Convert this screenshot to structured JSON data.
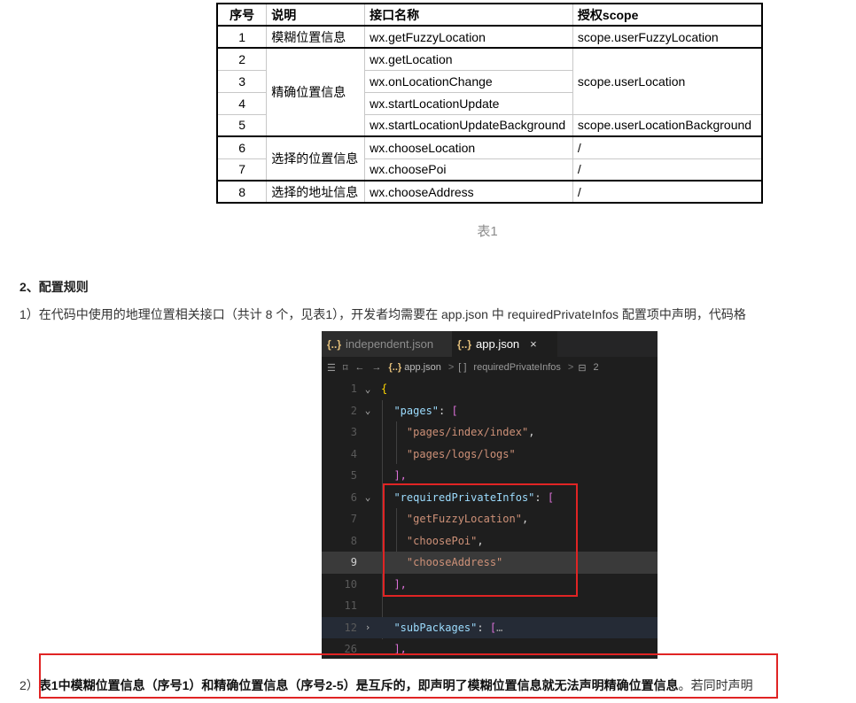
{
  "table": {
    "headers": [
      "序号",
      "说明",
      "接口名称",
      "授权scope"
    ],
    "rows": [
      {
        "no": "1",
        "desc": "模糊位置信息",
        "api": "wx.getFuzzyLocation",
        "scope": "scope.userFuzzyLocation"
      },
      {
        "no": "2",
        "desc": "精确位置信息",
        "api": "wx.getLocation",
        "scope": "scope.userLocation"
      },
      {
        "no": "3",
        "desc": "",
        "api": "wx.onLocationChange",
        "scope": ""
      },
      {
        "no": "4",
        "desc": "",
        "api": "wx.startLocationUpdate",
        "scope": ""
      },
      {
        "no": "5",
        "desc": "",
        "api": "wx.startLocationUpdateBackground",
        "scope": "scope.userLocationBackground"
      },
      {
        "no": "6",
        "desc": "选择的位置信息",
        "api": "wx.chooseLocation",
        "scope": "/"
      },
      {
        "no": "7",
        "desc": "",
        "api": "wx.choosePoi",
        "scope": "/"
      },
      {
        "no": "8",
        "desc": "选择的地址信息",
        "api": "wx.chooseAddress",
        "scope": "/"
      }
    ],
    "caption": "表1"
  },
  "section_title": "2、配置规则",
  "para1": "1）在代码中使用的地理位置相关接口（共计 8 个，见表1），开发者均需要在 app.json 中 requiredPrivateInfos 配置项中声明，代码格",
  "para2": {
    "prefix": "2）",
    "bold": "表1中模糊位置信息（序号1）和精确位置信息（序号2-5）是互斥的，即声明了模糊位置信息就无法声明精确位置信息",
    "rest": "。若同时声明"
  },
  "editor": {
    "tabs": [
      {
        "icon": "{..}",
        "label": "independent.json",
        "active": false
      },
      {
        "icon": "{..}",
        "label": "app.json",
        "active": true,
        "close": "×"
      }
    ],
    "breadcrumb": {
      "list_icon": "☰",
      "bookmark_icon": "⌑",
      "back": "←",
      "forward": "→",
      "file_icon": "{..}",
      "file": "app.json",
      "sep": ">",
      "array_icon": "[ ]",
      "key": "requiredPrivateInfos",
      "num_icon": "⊟",
      "num": "2"
    },
    "lines": [
      {
        "n": "1",
        "fold": "⌄"
      },
      {
        "n": "2",
        "fold": "⌄"
      },
      {
        "n": "3"
      },
      {
        "n": "4"
      },
      {
        "n": "5"
      },
      {
        "n": "6",
        "fold": "⌄"
      },
      {
        "n": "7"
      },
      {
        "n": "8"
      },
      {
        "n": "9",
        "current": true
      },
      {
        "n": "10"
      },
      {
        "n": "11"
      },
      {
        "n": "12",
        "fold": "›"
      },
      {
        "n": "26"
      }
    ],
    "code": {
      "open_brace": "{",
      "pages_key": "\"pages\"",
      "colon": ": ",
      "lbracket": "[",
      "page1": "\"pages/index/index\"",
      "page2": "\"pages/logs/logs\"",
      "comma": ",",
      "rbracket_comma": "],",
      "rpi_key": "\"requiredPrivateInfos\"",
      "v1": "\"getFuzzyLocation\"",
      "v2": "\"choosePoi\"",
      "v3": "\"chooseAddress\"",
      "sub_key": "\"subPackages\"",
      "ellipsis": "…"
    }
  }
}
